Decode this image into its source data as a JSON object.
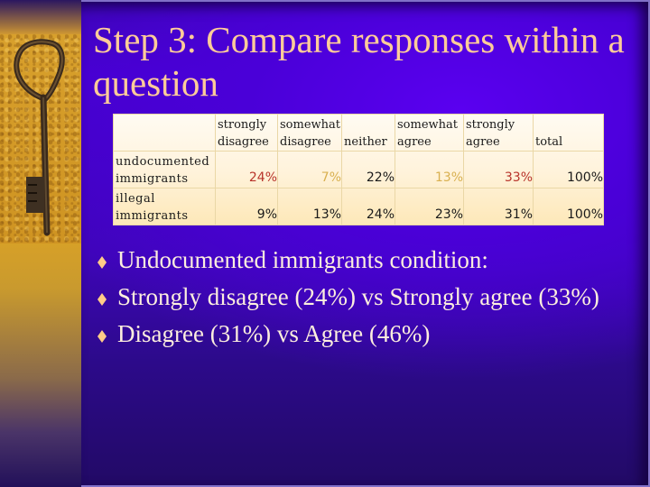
{
  "slide": {
    "title": "Step 3: Compare responses within a question",
    "colors": {
      "title": "#ffcc99",
      "background": "#4600d0",
      "highlight_red": "#b8342a",
      "highlight_gold": "#d9b050",
      "bullet": "#ffcc88",
      "body_text": "#fdeede"
    }
  },
  "table": {
    "headers": [
      "",
      "strongly disagree",
      "somewhat disagree",
      "neither",
      "somewhat agree",
      "strongly agree",
      "total"
    ],
    "header_lines": [
      [
        "",
        ""
      ],
      [
        "strongly",
        "disagree"
      ],
      [
        "somewhat",
        "disagree"
      ],
      [
        "",
        "neither"
      ],
      [
        "somewhat",
        "agree"
      ],
      [
        "strongly",
        "agree"
      ],
      [
        "",
        "total"
      ]
    ],
    "rows": [
      {
        "label_lines": [
          "undocumented",
          "immigrants"
        ],
        "values": [
          "24%",
          "7%",
          "22%",
          "13%",
          "33%",
          "100%"
        ]
      },
      {
        "label_lines": [
          "illegal",
          "immigrants"
        ],
        "values": [
          "9%",
          "13%",
          "24%",
          "23%",
          "31%",
          "100%"
        ]
      }
    ]
  },
  "bullets": [
    {
      "icon": "diamond-bullet-icon",
      "text": "Undocumented immigrants condition:"
    },
    {
      "icon": "diamond-bullet-icon",
      "text": "Strongly disagree (24%) vs Strongly agree (33%)"
    },
    {
      "icon": "diamond-bullet-icon",
      "text": "Disagree (31%) vs Agree (46%)"
    }
  ],
  "decoration": {
    "side_image": "antique-key-on-sand"
  }
}
